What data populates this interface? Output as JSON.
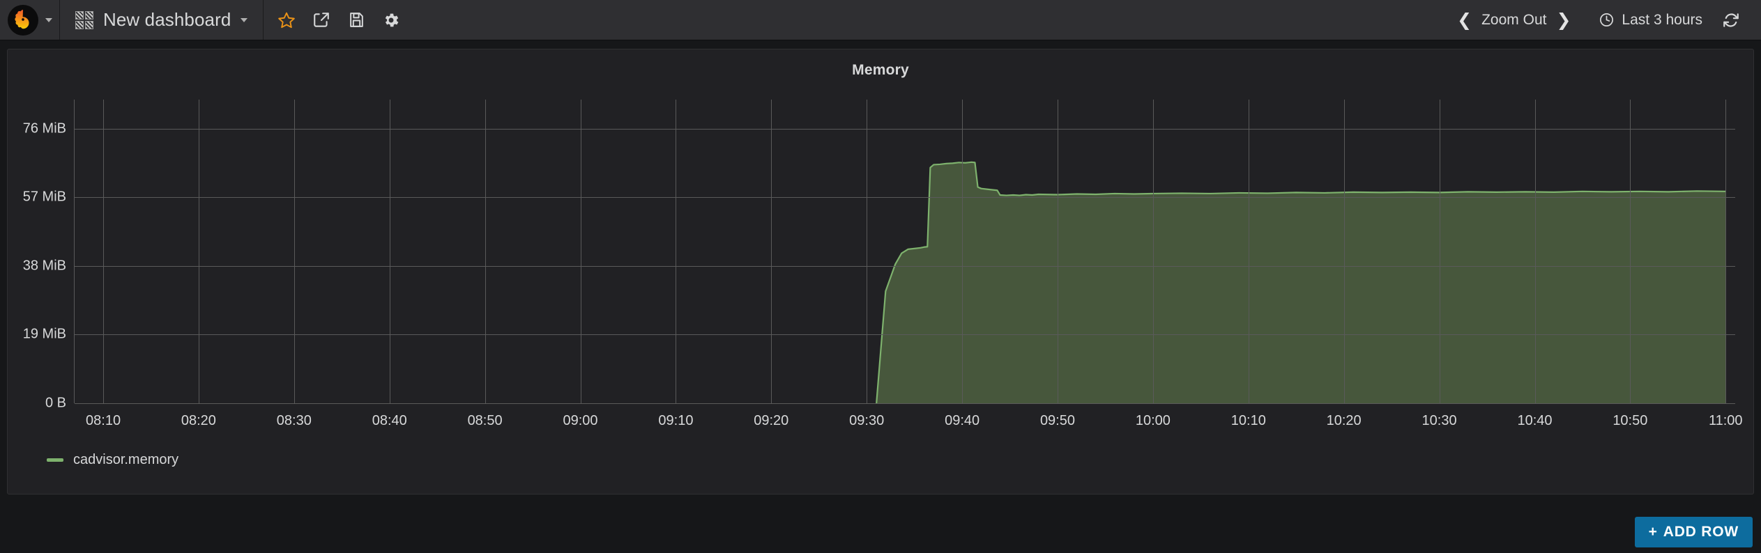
{
  "topnav": {
    "logo_icon": "grafana-logo-icon",
    "logo_caret_icon": "chevron-down-icon",
    "dashboard_icon": "dashboard-grid-icon",
    "dashboard_title": "New dashboard",
    "dashboard_caret_icon": "chevron-down-icon",
    "icons": [
      {
        "name": "star-icon",
        "title": "Mark as favorite"
      },
      {
        "name": "share-icon",
        "title": "Share dashboard"
      },
      {
        "name": "save-icon",
        "title": "Save dashboard"
      },
      {
        "name": "gear-icon",
        "title": "Dashboard settings"
      }
    ],
    "time_controls": {
      "prev_icon": "chevron-left-icon",
      "zoom_out_label": "Zoom Out",
      "next_icon": "chevron-right-icon",
      "clock_icon": "clock-icon",
      "time_range_label": "Last 3 hours",
      "refresh_icon": "refresh-icon"
    }
  },
  "panel": {
    "title": "Memory",
    "legend": [
      {
        "label": "cadvisor.memory",
        "color": "#7eb26d"
      }
    ]
  },
  "footer": {
    "add_row_label": "ADD ROW",
    "add_row_plus_icon": "plus-icon",
    "add_row_color": "#0d6c9e"
  },
  "colors": {
    "page_bg": "#161719",
    "nav_bg": "#2f2f32",
    "panel_bg": "#212124",
    "grid": "#5a5a5a",
    "text": "#d8d9da",
    "series_line": "#7eb26d",
    "series_fill": "#47573c",
    "star": "#eb9317",
    "accent_blue": "#0d6c9e"
  },
  "chart_data": {
    "type": "area",
    "title": "Memory",
    "xlabel": "",
    "ylabel": "",
    "grid": true,
    "legend_position": "bottom-left",
    "series": [
      {
        "name": "cadvisor.memory",
        "color": "#7eb26d",
        "unit": "MiB",
        "points": [
          [
            9.517,
            0
          ],
          [
            9.533,
            31.0
          ],
          [
            9.55,
            38.5
          ],
          [
            9.561,
            41.5
          ],
          [
            9.572,
            42.6
          ],
          [
            9.583,
            42.8
          ],
          [
            9.594,
            43.0
          ],
          [
            9.6,
            43.2
          ],
          [
            9.606,
            43.3
          ],
          [
            9.611,
            65.2
          ],
          [
            9.617,
            66.0
          ],
          [
            9.628,
            66.1
          ],
          [
            9.639,
            66.3
          ],
          [
            9.65,
            66.4
          ],
          [
            9.661,
            66.6
          ],
          [
            9.672,
            66.5
          ],
          [
            9.683,
            66.7
          ],
          [
            9.689,
            66.6
          ],
          [
            9.694,
            59.8
          ],
          [
            9.7,
            59.4
          ],
          [
            9.711,
            59.2
          ],
          [
            9.722,
            59.0
          ],
          [
            9.728,
            58.9
          ],
          [
            9.733,
            57.6
          ],
          [
            9.744,
            57.5
          ],
          [
            9.756,
            57.6
          ],
          [
            9.767,
            57.5
          ],
          [
            9.778,
            57.7
          ],
          [
            9.789,
            57.6
          ],
          [
            9.8,
            57.8
          ],
          [
            9.833,
            57.7
          ],
          [
            9.867,
            57.9
          ],
          [
            9.9,
            57.8
          ],
          [
            9.933,
            58.0
          ],
          [
            9.967,
            57.9
          ],
          [
            10.0,
            58.0
          ],
          [
            10.05,
            58.1
          ],
          [
            10.1,
            58.0
          ],
          [
            10.15,
            58.2
          ],
          [
            10.2,
            58.1
          ],
          [
            10.25,
            58.3
          ],
          [
            10.3,
            58.2
          ],
          [
            10.35,
            58.4
          ],
          [
            10.4,
            58.3
          ],
          [
            10.45,
            58.4
          ],
          [
            10.5,
            58.3
          ],
          [
            10.55,
            58.5
          ],
          [
            10.6,
            58.4
          ],
          [
            10.65,
            58.5
          ],
          [
            10.7,
            58.4
          ],
          [
            10.75,
            58.6
          ],
          [
            10.8,
            58.5
          ],
          [
            10.85,
            58.6
          ],
          [
            10.9,
            58.5
          ],
          [
            10.95,
            58.7
          ],
          [
            11.0,
            58.6
          ]
        ]
      }
    ],
    "y_axis": {
      "ticks": [
        {
          "value": 0,
          "label": "0 B"
        },
        {
          "value": 19,
          "label": "19 MiB"
        },
        {
          "value": 38,
          "label": "38 MiB"
        },
        {
          "value": 57,
          "label": "57 MiB"
        },
        {
          "value": 76,
          "label": "76 MiB"
        }
      ],
      "min": 0,
      "max": 84
    },
    "x_axis": {
      "min": 8.1167,
      "max": 11.0167,
      "ticks": [
        {
          "value": 8.1667,
          "label": "08:10"
        },
        {
          "value": 8.3333,
          "label": "08:20"
        },
        {
          "value": 8.5,
          "label": "08:30"
        },
        {
          "value": 8.6667,
          "label": "08:40"
        },
        {
          "value": 8.8333,
          "label": "08:50"
        },
        {
          "value": 9.0,
          "label": "09:00"
        },
        {
          "value": 9.1667,
          "label": "09:10"
        },
        {
          "value": 9.3333,
          "label": "09:20"
        },
        {
          "value": 9.5,
          "label": "09:30"
        },
        {
          "value": 9.6667,
          "label": "09:40"
        },
        {
          "value": 9.8333,
          "label": "09:50"
        },
        {
          "value": 10.0,
          "label": "10:00"
        },
        {
          "value": 10.1667,
          "label": "10:10"
        },
        {
          "value": 10.3333,
          "label": "10:20"
        },
        {
          "value": 10.5,
          "label": "10:30"
        },
        {
          "value": 10.6667,
          "label": "10:40"
        },
        {
          "value": 10.8333,
          "label": "10:50"
        },
        {
          "value": 11.0,
          "label": "11:00"
        }
      ]
    }
  }
}
